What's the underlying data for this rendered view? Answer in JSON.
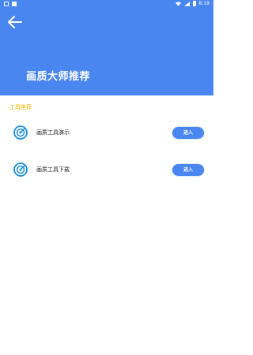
{
  "status_bar": {
    "time": "8:19"
  },
  "header": {
    "title": "画质大师推荐"
  },
  "section": {
    "title": "工具推荐"
  },
  "tools": [
    {
      "label": "画质工具演示",
      "button": "进入"
    },
    {
      "label": "画质工具下载",
      "button": "进入"
    }
  ],
  "colors": {
    "primary": "#4a86f0",
    "accent": "#f5b400",
    "icon": "#1a8fd8"
  },
  "icons": {
    "back": "arrow-left-icon",
    "tool": "target-icon"
  }
}
